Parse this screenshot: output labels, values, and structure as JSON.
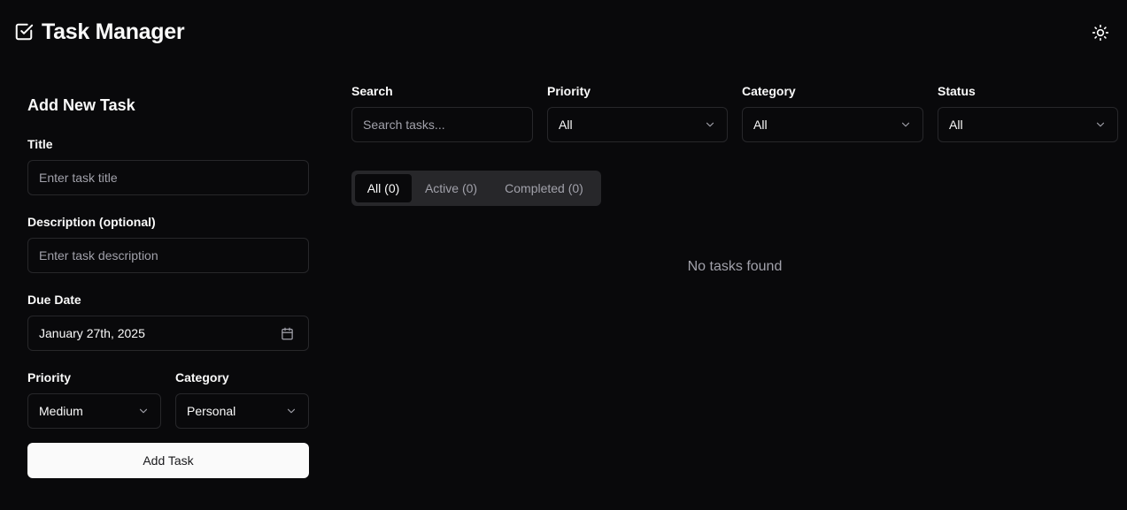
{
  "header": {
    "title": "Task Manager",
    "logo_icon": "square-check-icon",
    "theme_icon": "sun-icon"
  },
  "form": {
    "heading": "Add New Task",
    "title_label": "Title",
    "title_placeholder": "Enter task title",
    "title_value": "",
    "description_label": "Description (optional)",
    "description_placeholder": "Enter task description",
    "description_value": "",
    "due_date_label": "Due Date",
    "due_date_value": "January 27th, 2025",
    "priority_label": "Priority",
    "priority_value": "Medium",
    "category_label": "Category",
    "category_value": "Personal",
    "submit_label": "Add Task"
  },
  "filters": {
    "search_label": "Search",
    "search_placeholder": "Search tasks...",
    "priority_label": "Priority",
    "priority_value": "All",
    "category_label": "Category",
    "category_value": "All",
    "status_label": "Status",
    "status_value": "All"
  },
  "tabs": [
    {
      "label": "All (0)",
      "active": true
    },
    {
      "label": "Active (0)",
      "active": false
    },
    {
      "label": "Completed (0)",
      "active": false
    }
  ],
  "empty_state": "No tasks found",
  "colors": {
    "background": "#09090b",
    "border": "#27272a",
    "muted_text": "#a1a1aa",
    "foreground": "#fafafa"
  }
}
